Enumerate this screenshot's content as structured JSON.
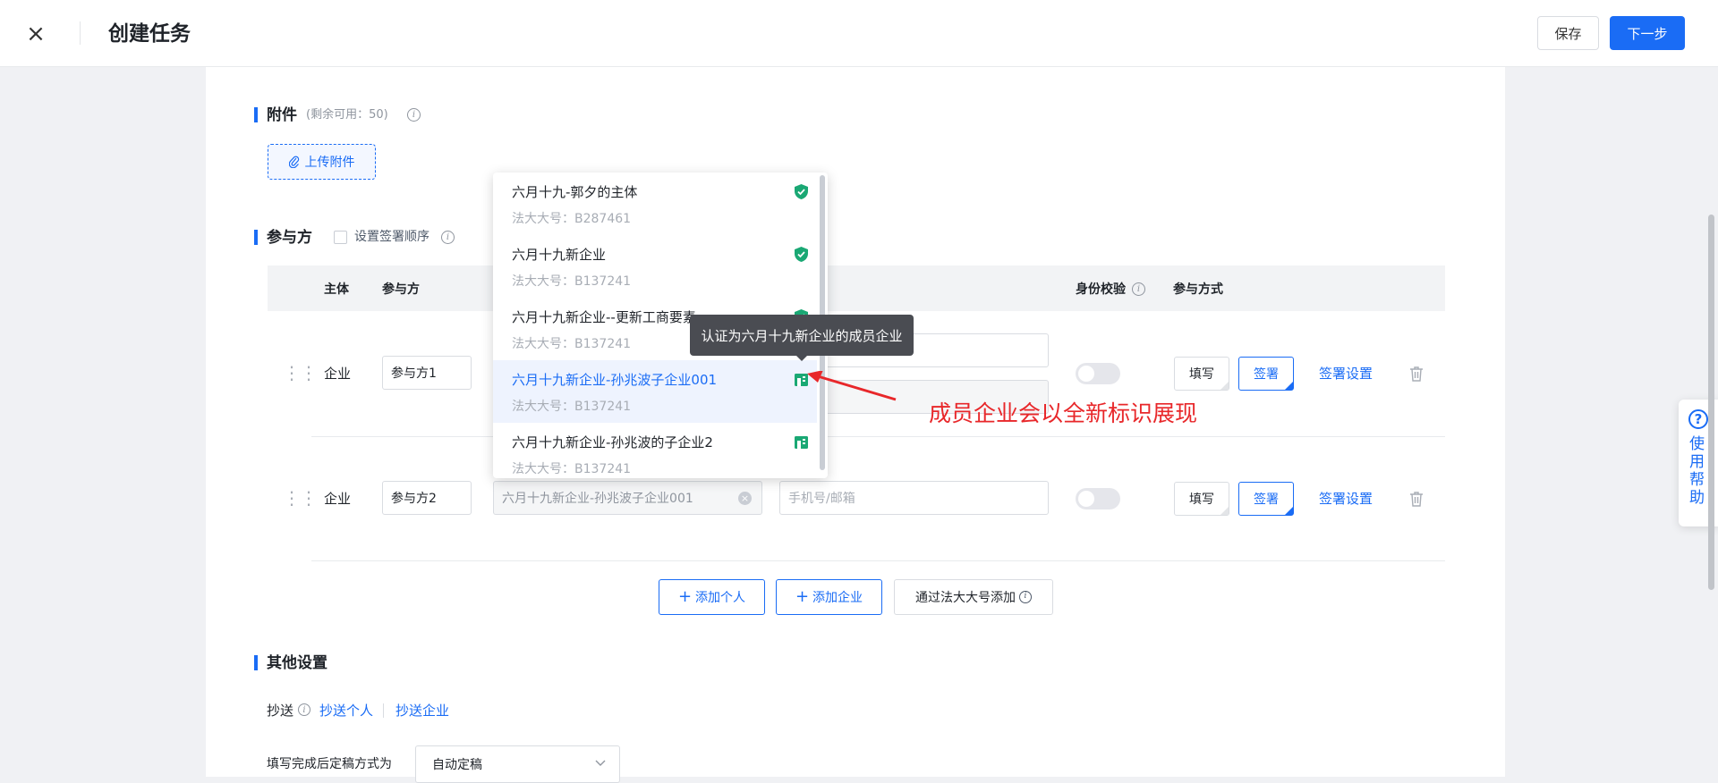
{
  "header": {
    "close_glyph": "×",
    "title": "创建任务",
    "save_label": "保存",
    "next_label": "下一步"
  },
  "attachments": {
    "title": "附件",
    "remaining": "(剩余可用：50)",
    "upload_label": "上传附件"
  },
  "participants": {
    "title": "参与方",
    "order_checkbox_label": "设置签署顺序",
    "columns": {
      "subject": "主体",
      "party": "参与方",
      "identity_check": "身份校验",
      "method": "参与方式"
    },
    "rows": [
      {
        "subject": "企业",
        "party": "参与方1",
        "fill_label": "填写",
        "sign_label": "签署",
        "sign_settings": "签署设置"
      },
      {
        "subject": "企业",
        "party": "参与方2",
        "company_value": "六月十九新企业-孙兆波子企业001",
        "contact_placeholder": "手机号/邮箱",
        "fill_label": "填写",
        "sign_label": "签署",
        "sign_settings": "签署设置"
      }
    ],
    "add_person": "添加个人",
    "add_company": "添加企业",
    "add_by_number": "通过法大大号添加"
  },
  "dropdown": {
    "items": [
      {
        "name": "六月十九-郭夕的主体",
        "sub": "法大大号：B287461",
        "icon": "verified-shield-icon"
      },
      {
        "name": "六月十九新企业",
        "sub": "法大大号：B137241",
        "icon": "verified-shield-icon"
      },
      {
        "name": "六月十九新企业--更新工商要素",
        "sub": "法大大号：B137241",
        "icon": "verified-shield-icon"
      },
      {
        "name": "六月十九新企业-孙兆波子企业001",
        "sub": "法大大号：B137241",
        "icon": "member-enterprise-icon"
      },
      {
        "name": "六月十九新企业-孙兆波的子企业2",
        "sub": "法大大号：B137241",
        "icon": "member-enterprise-icon"
      }
    ],
    "tooltip": "认证为六月十九新企业的成员企业"
  },
  "annotation": {
    "callout_text": "成员企业会以全新标识展现",
    "color": "#e8272a"
  },
  "other_settings": {
    "title": "其他设置",
    "cc_label": "抄送",
    "cc_person": "抄送个人",
    "cc_company": "抄送企业",
    "finalize_label": "填写完成后定稿方式为",
    "finalize_value": "自动定稿"
  },
  "help": {
    "label": "使用帮助"
  },
  "colors": {
    "accent": "#1a6cf5",
    "verified": "#1aa874",
    "annotation": "#e8272a"
  }
}
